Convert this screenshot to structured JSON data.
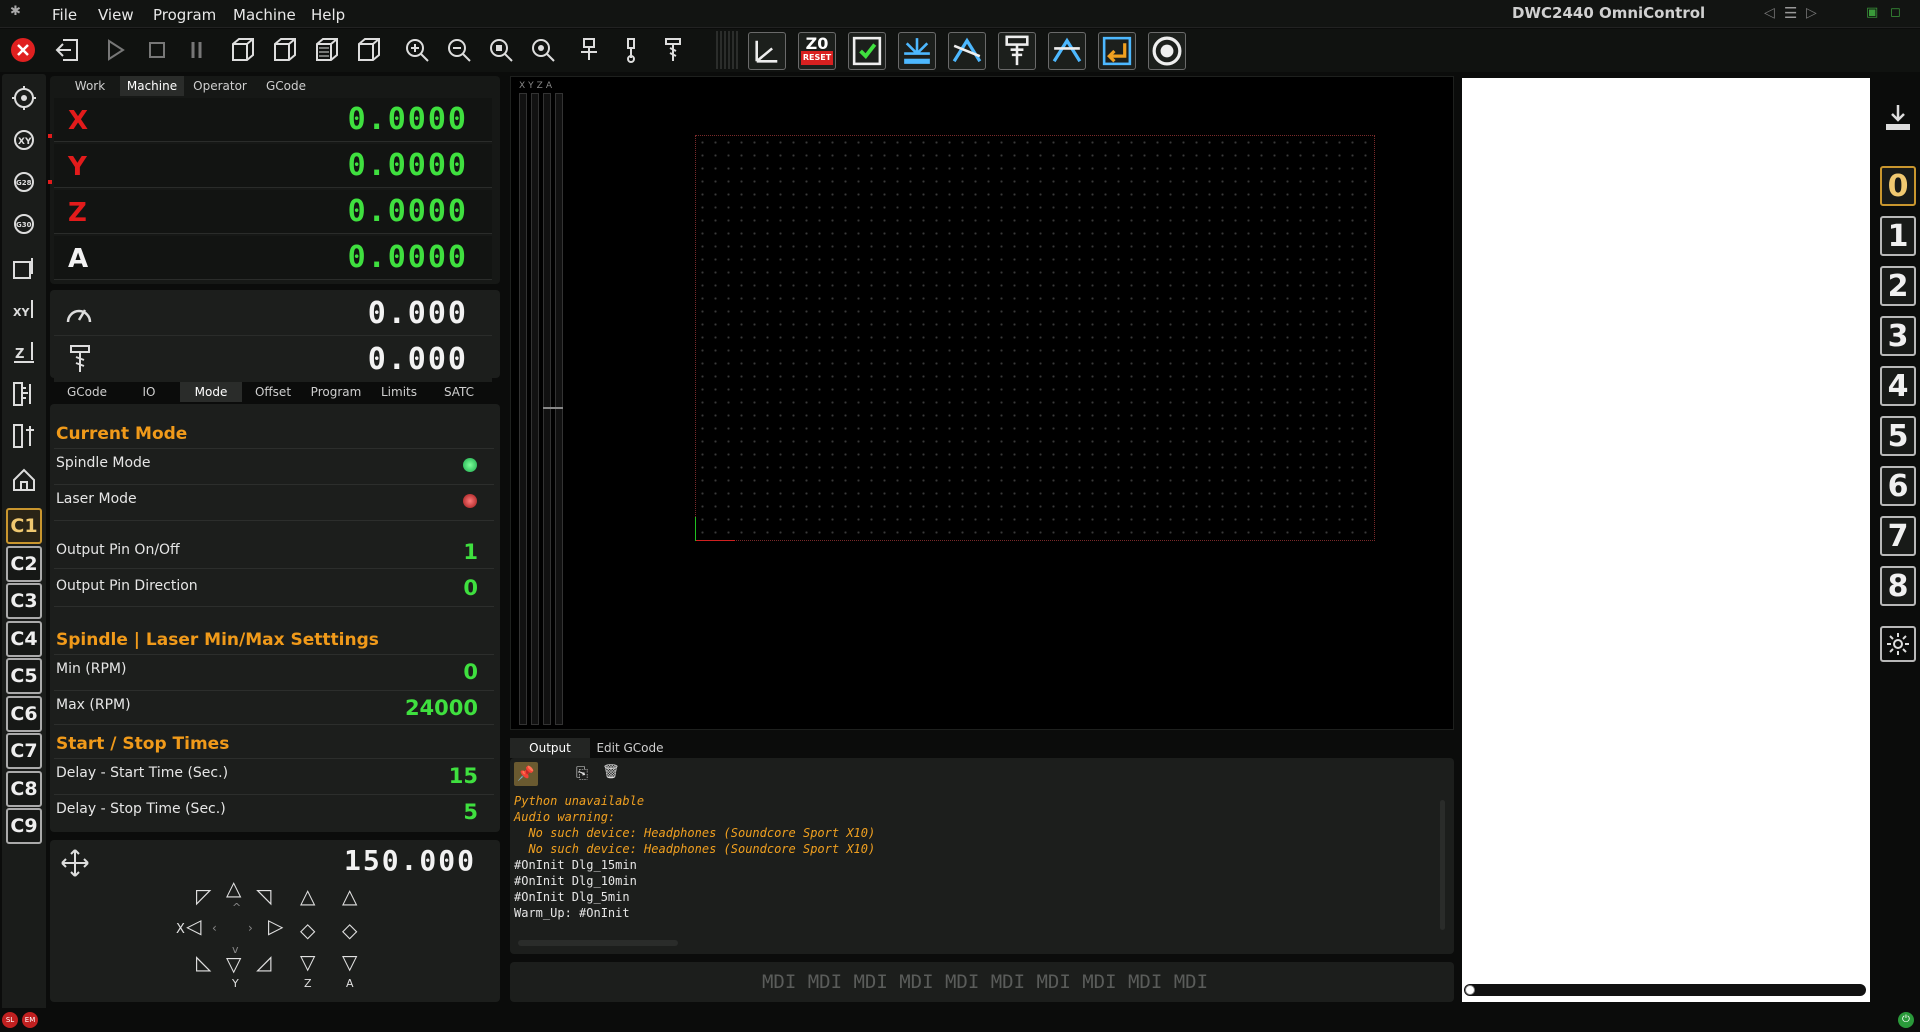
{
  "menubar": {
    "items": [
      "File",
      "View",
      "Program",
      "Machine",
      "Help"
    ],
    "title": "DWC2440 OmniControl"
  },
  "dro": {
    "tabs": [
      "Work",
      "Machine",
      "Operator",
      "GCode"
    ],
    "active_tab": "Machine",
    "axes": [
      {
        "label": "X",
        "value": "0.0000"
      },
      {
        "label": "Y",
        "value": "0.0000"
      },
      {
        "label": "Z",
        "value": "0.0000"
      },
      {
        "label": "A",
        "value": "0.0000"
      }
    ],
    "feed": "0.000",
    "spindle": "0.000"
  },
  "settings": {
    "tabs": [
      "GCode",
      "IO",
      "Mode",
      "Offset",
      "Program",
      "Limits",
      "SATC"
    ],
    "active_tab": "Mode",
    "current_mode_title": "Current Mode",
    "spindle_mode_label": "Spindle Mode",
    "laser_mode_label": "Laser Mode",
    "output_pin_onoff_label": "Output Pin On/Off",
    "output_pin_onoff_value": "1",
    "output_pin_dir_label": "Output Pin Direction",
    "output_pin_dir_value": "0",
    "minmax_title": "Spindle | Laser Min/Max Setttings",
    "min_label": "Min (RPM)",
    "min_value": "0",
    "max_label": "Max (RPM)",
    "max_value": "24000",
    "times_title": "Start / Stop Times",
    "start_label": "Delay - Start Time (Sec.)",
    "start_value": "15",
    "stop_label": "Delay - Stop Time (Sec.)",
    "stop_value": "5"
  },
  "jog": {
    "step": "150.000",
    "axis_labels": [
      "X",
      "Y",
      "Z",
      "A"
    ]
  },
  "sidebar": {
    "custom_buttons": [
      "C1",
      "C2",
      "C3",
      "C4",
      "C5",
      "C6",
      "C7",
      "C8",
      "C9"
    ],
    "active": "C1"
  },
  "viewport": {
    "axis_labels": [
      "X",
      "Y",
      "Z",
      "A"
    ]
  },
  "console": {
    "tabs": [
      "Output",
      "Edit GCode"
    ],
    "lines": [
      {
        "text": "Python unavailable",
        "type": "warn"
      },
      {
        "text": "Audio warning:",
        "type": "warn"
      },
      {
        "text": "  No such device: Headphones (Soundcore Sport X10)",
        "type": "warn"
      },
      {
        "text": "  No such device: Headphones (Soundcore Sport X10)",
        "type": "warn"
      },
      {
        "text": "#OnInit Dlg_15min",
        "type": "info"
      },
      {
        "text": "#OnInit Dlg_10min",
        "type": "info"
      },
      {
        "text": "#OnInit Dlg_5min",
        "type": "info"
      },
      {
        "text": "Warm_Up: #OnInit",
        "type": "info"
      }
    ]
  },
  "mdi": {
    "placeholder": "MDI MDI MDI MDI MDI MDI MDI MDI MDI MDI"
  },
  "toolbar": {
    "z0_label": "Z0",
    "z0_sub": "RESET"
  },
  "rightbar": {
    "numbers": [
      "0",
      "1",
      "2",
      "3",
      "4",
      "5",
      "6",
      "7",
      "8"
    ],
    "active": "0"
  },
  "statusbar": {
    "left_badges": [
      "SL",
      "EM"
    ]
  },
  "colors": {
    "accent": "#f09a1a",
    "dro_green": "#3fe03f",
    "axis_red": "#e21b1b",
    "active_gold": "#c9962e"
  }
}
